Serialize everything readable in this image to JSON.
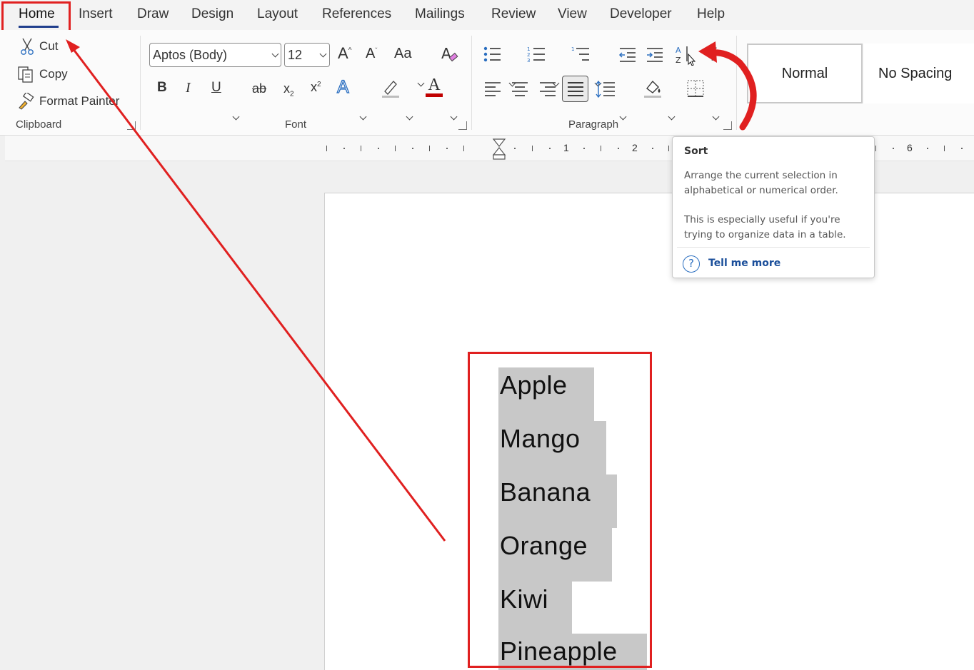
{
  "tabs": [
    "Home",
    "Insert",
    "Draw",
    "Design",
    "Layout",
    "References",
    "Mailings",
    "Review",
    "View",
    "Developer",
    "Help"
  ],
  "clipboard": {
    "cut": "Cut",
    "copy": "Copy",
    "format_painter": "Format Painter",
    "label": "Clipboard"
  },
  "font": {
    "name": "Aptos (Body)",
    "size": "12",
    "label": "Font",
    "case_label": "Aa"
  },
  "paragraph": {
    "label": "Paragraph"
  },
  "styles": {
    "normal": "Normal",
    "no_spacing": "No Spacing"
  },
  "ruler": {
    "numbers": [
      "1",
      "2",
      "6"
    ]
  },
  "tooltip": {
    "title": "Sort",
    "para1": "Arrange the current selection in alphabetical or numerical order.",
    "para2": "This is especially useful if you're trying to organize data in a table.",
    "link": "Tell me more"
  },
  "document": {
    "items": [
      "Apple",
      "Mango",
      "Banana",
      "Orange",
      "Kiwi",
      "Pineapple"
    ]
  },
  "colors": {
    "annotation": "#e02020",
    "selection": "#c8c8c8",
    "font_color": "#c00000",
    "accent": "#1f3e8c"
  }
}
